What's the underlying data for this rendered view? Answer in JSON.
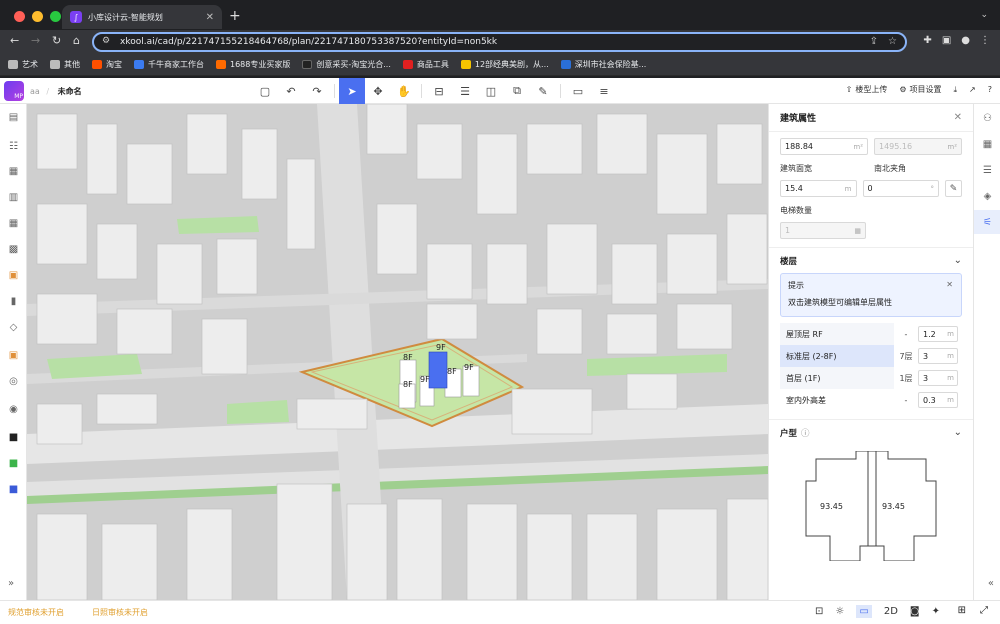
{
  "browser": {
    "tab_title": "小库设计云-智能规划",
    "url": "xkool.ai/cad/p/221747155218464768/plan/221747180753387520?entityId=non5kk",
    "bookmarks": [
      "艺术",
      "其他",
      "淘宝",
      "千牛商家工作台",
      "1688专业买家版",
      "创意采买-淘宝光合...",
      "商品工具",
      "12部经典美剧，从...",
      "深圳市社会保险基..."
    ]
  },
  "app": {
    "project": "aa",
    "plan_name": "未命名",
    "logo_badge": "MP",
    "upload_label": "楼型上传",
    "settings_label": "项目设置"
  },
  "panel": {
    "title": "建筑属性",
    "area_value": "188.84",
    "area_unit": "m²",
    "area_total": "1495.16",
    "area_total_unit": "m²",
    "width_label": "建筑面宽",
    "width_value": "15.4",
    "width_unit": "m",
    "angle_label": "南北夹角",
    "angle_value": "0",
    "angle_unit": "°",
    "elevator_label": "电梯数量",
    "elevator_value": "1",
    "floors_section": "楼层",
    "tip_title": "提示",
    "tip_text": "双击建筑模型可编辑单层属性",
    "floors": [
      {
        "name": "屋顶层 RF",
        "count": "-",
        "value": "1.2",
        "unit": "m",
        "selected": false
      },
      {
        "name": "标准层 (2-8F)",
        "count": "7层",
        "value": "3",
        "unit": "m",
        "selected": true
      },
      {
        "name": "首层 (1F)",
        "count": "1层",
        "value": "3",
        "unit": "m",
        "selected": false
      },
      {
        "name": "室内外高差",
        "count": "-",
        "value": "0.3",
        "unit": "m",
        "selected": false
      }
    ],
    "unit_section": "户型",
    "unit_areas": [
      "93.45",
      "93.45"
    ]
  },
  "map_labels": [
    "8F",
    "9F",
    "8F",
    "9F",
    "8F",
    "9F"
  ],
  "status": {
    "left1": "规范审核未开启",
    "left2": "日照审核未开启",
    "mode_2d": "2D"
  }
}
